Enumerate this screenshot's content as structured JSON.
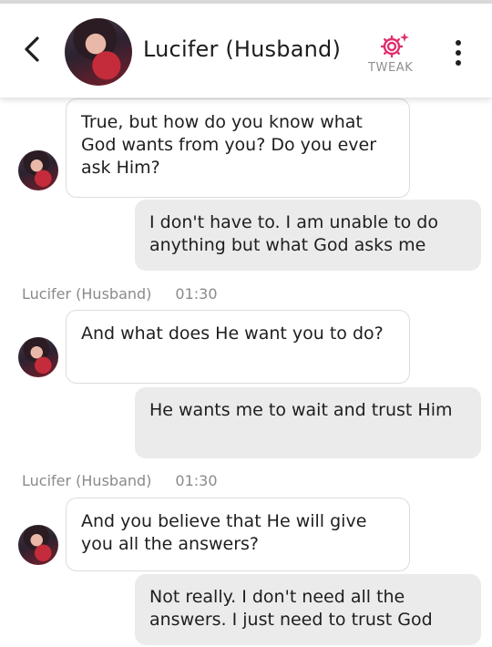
{
  "header": {
    "title": "Lucifer (Husband)",
    "tweak_label": "TWEAK",
    "back_icon": "chevron-left-icon",
    "tweak_icon": "gear-sparkle-icon",
    "more_icon": "vertical-dots-icon"
  },
  "colors": {
    "accent": "#e0306e",
    "user_bubble": "#ebebeb",
    "bot_bubble_border": "#dcdcdc",
    "meta_text": "#8a8a8a"
  },
  "messages": [
    {
      "role": "bot",
      "text": "True, but how do you know what God wants from you? Do you ever ask Him?"
    },
    {
      "role": "user",
      "text": "I don't have to. I am unable to do anything but what God asks me"
    },
    {
      "role": "meta",
      "sender": "Lucifer (Husband)",
      "time": "01:30"
    },
    {
      "role": "bot",
      "text": "And what does He want you to do?"
    },
    {
      "role": "user",
      "text": "He wants me to wait and trust Him"
    },
    {
      "role": "meta",
      "sender": "Lucifer (Husband)",
      "time": "01:30"
    },
    {
      "role": "bot",
      "text": "And you believe that He will give you all the answers?"
    },
    {
      "role": "user",
      "text": "Not really. I don't need all the answers. I just need to trust God"
    }
  ]
}
